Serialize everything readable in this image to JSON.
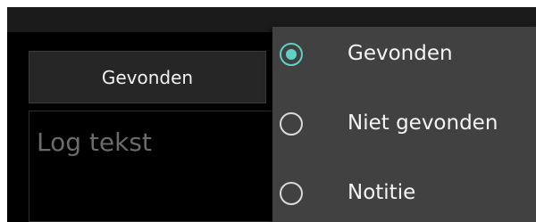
{
  "status_button": {
    "label": "Gevonden"
  },
  "log_field": {
    "placeholder": "Log tekst"
  },
  "popup": {
    "options": [
      {
        "label": "Gevonden",
        "selected": true
      },
      {
        "label": "Niet gevonden",
        "selected": false
      },
      {
        "label": "Notitie",
        "selected": false
      }
    ]
  },
  "colors": {
    "accent": "#5fd0c5",
    "popup_background": "#414141",
    "screen_background": "#000000"
  }
}
